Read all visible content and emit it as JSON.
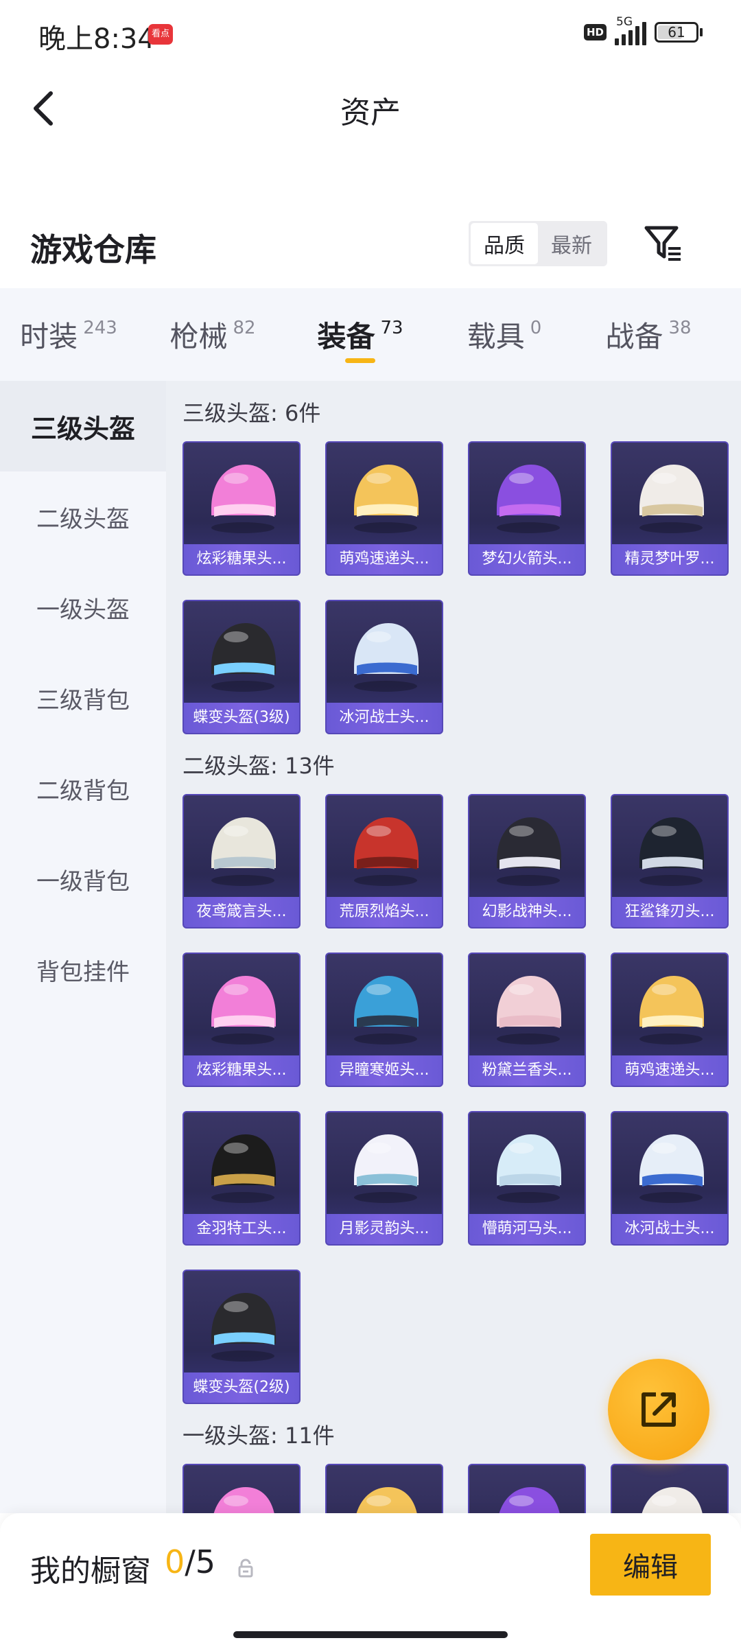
{
  "status": {
    "time": "晚上8:34",
    "app_badge": "看点",
    "hd": "HD",
    "network": "5G",
    "battery": "61",
    "battery_level": 0.61
  },
  "header": {
    "title": "资产"
  },
  "warehouse": {
    "title": "游戏仓库",
    "sort_options": [
      "品质",
      "最新"
    ],
    "selected_sort": "品质"
  },
  "tabs": [
    {
      "label": "时装",
      "count": "243"
    },
    {
      "label": "枪械",
      "count": "82"
    },
    {
      "label": "装备",
      "count": "73",
      "active": true
    },
    {
      "label": "载具",
      "count": "0"
    },
    {
      "label": "战备",
      "count": "38"
    }
  ],
  "sidebar": {
    "items": [
      "三级头盔",
      "二级头盔",
      "一级头盔",
      "三级背包",
      "二级背包",
      "一级背包",
      "背包挂件"
    ],
    "active": "三级头盔"
  },
  "sections": [
    {
      "title": "三级头盔: 6件",
      "items": [
        "炫彩糖果头...",
        "萌鸡速递头...",
        "梦幻火箭头...",
        "精灵梦叶罗...",
        "蝶变头盔(3级)",
        "冰河战士头..."
      ]
    },
    {
      "title": "二级头盔: 13件",
      "items": [
        "夜鸢箴言头...",
        "荒原烈焰头...",
        "幻影战神头...",
        "狂鲨锋刃头...",
        "炫彩糖果头...",
        "异瞳寒姬头...",
        "粉黛兰香头...",
        "萌鸡速递头...",
        "金羽特工头...",
        "月影灵韵头...",
        "懵萌河马头...",
        "冰河战士头...",
        "蝶变头盔(2级)"
      ]
    },
    {
      "title": "一级头盔: 11件",
      "items": [
        "",
        "",
        "",
        ""
      ]
    }
  ],
  "showcase": {
    "title": "我的橱窗",
    "current": "0",
    "total": "/5",
    "edit_label": "编辑"
  },
  "colors": {
    "accent": "#f7b515",
    "card_bg": "#2c2a55",
    "card_label": "#6a5ad6"
  },
  "icons": [
    "back-arrow-icon",
    "filter-icon",
    "lock-icon",
    "share-icon"
  ]
}
